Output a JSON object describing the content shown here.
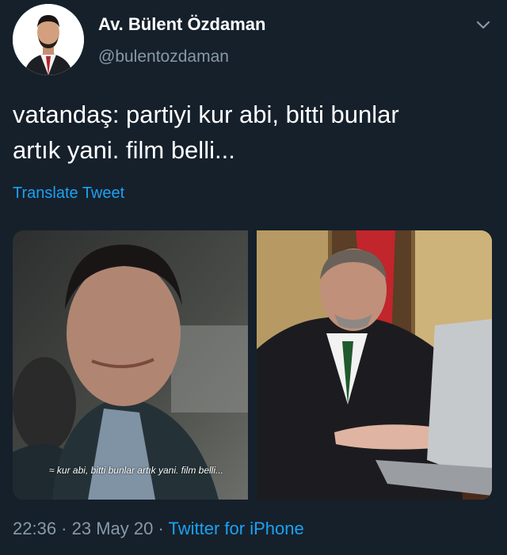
{
  "author": {
    "name": "Av. Bülent Özdaman",
    "handle": "@bulentozdaman",
    "avatar_icon": "profile-photo"
  },
  "tweet": {
    "text_line1": "vatandaş: partiyi kur abi, bitti bunlar",
    "text_line2": "artık yani. film belli...",
    "translate_label": "Translate Tweet"
  },
  "media": {
    "left_caption": "≈ kur abi, bitti bunlar artık yani. film belli..."
  },
  "footer": {
    "time": "22:36",
    "separator1": " · ",
    "date": "23 May 20",
    "separator2": " · ",
    "source": "Twitter for iPhone"
  },
  "colors": {
    "background": "#15202b",
    "accent": "#1da1f2",
    "muted": "#8899a6"
  }
}
